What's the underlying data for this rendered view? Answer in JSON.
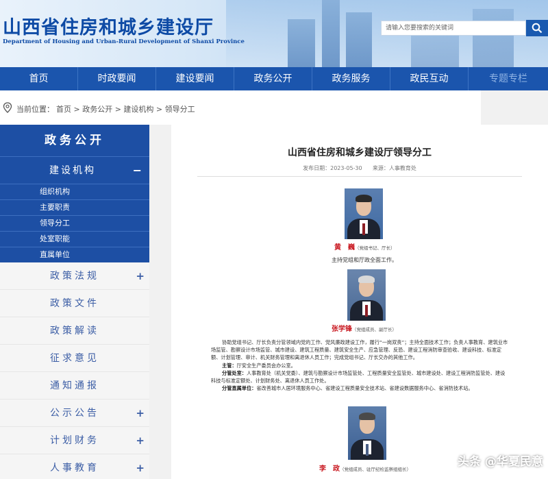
{
  "header": {
    "title": "山西省住房和城乡建设厅",
    "subtitle": "Department of Housing and Urban-Rural Development of Shanxi Province",
    "search_placeholder": "请输入您要搜索的关键词"
  },
  "nav": [
    "首页",
    "时政要闻",
    "建设要闻",
    "政务公开",
    "政务服务",
    "政民互动",
    "专题专栏"
  ],
  "breadcrumb": {
    "label": "当前位置：",
    "path": "首页 > 政务公开 > 建设机构 > 领导分工"
  },
  "sidebar": {
    "heading": "政务公开",
    "section": "建设机构",
    "section_toggle": "−",
    "links": [
      "组织机构",
      "主要职责",
      "领导分工",
      "处室职能",
      "直属单位"
    ],
    "categories": [
      {
        "label": "政策法规",
        "toggle": "+"
      },
      {
        "label": "政策文件",
        "toggle": ""
      },
      {
        "label": "政策解读",
        "toggle": ""
      },
      {
        "label": "征求意见",
        "toggle": ""
      },
      {
        "label": "通知通报",
        "toggle": ""
      },
      {
        "label": "公示公告",
        "toggle": "+"
      },
      {
        "label": "计划财务",
        "toggle": "+"
      },
      {
        "label": "人事教育",
        "toggle": "+"
      }
    ]
  },
  "article": {
    "title": "山西省住房和城乡建设厅领导分工",
    "date_label": "发布日期：",
    "date": "2023-05-30",
    "source_label": "来源：",
    "source": "人事教育处",
    "leaders": [
      {
        "name": "黄　巍",
        "role": "（党组书记、厅长）",
        "duty": "主持党组和厅政全面工作。"
      },
      {
        "name": "张学锋",
        "role": "（党组成员、副厅长）",
        "duty": ""
      },
      {
        "name": "李　政",
        "role": "（党组成员、驻厅纪检监察组组长）",
        "duty": ""
      }
    ],
    "para1": "协助党组书记、厅长负责分管领域内党的工作、党风廉政建设工作，履行“一岗双责”；主持全面技术工作；负责人事教育、建筑业市场监管、勘察设计市场监管、城市建设、建筑工程质量、建筑安全生产、应急管理、反恐、建设工程消防审查验收、建设科技、标准定额、计划管理、审计、机关财务管理和离退休人员工作；完成党组书记、厅长交办的其他工作。",
    "lead_label": "主管：",
    "lead_text": "厅安全生产委员会办公室。",
    "dept_label": "分管处室：",
    "dept_text": "人事教育处（机关党委）、建筑与勘察设计市场监管处、工程质量安全监管处、城市建设处、建设工程消防监管处、建设科技与标准定额处、计划财务处、离退休人员工作处。",
    "unit_label": "分管直属单位：",
    "unit_text": "省改善城市人居环境服务中心、省建设工程质量安全技术站、省建设数据服务中心、省消防技术站。"
  },
  "watermark": "头条 @华夏民意"
}
